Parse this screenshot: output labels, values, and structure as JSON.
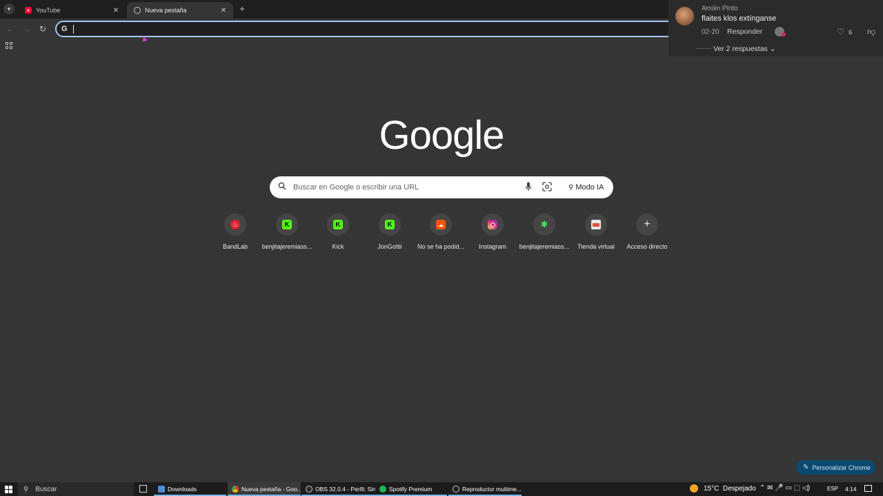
{
  "tabs": [
    {
      "label": "YouTube"
    },
    {
      "label": "Nueva pestaña"
    }
  ],
  "omnibox": {
    "value": ""
  },
  "comment": {
    "author": "Amiiin Pinto",
    "text": "flaites klos extínganse",
    "time": "02-20",
    "reply_label": "Responder",
    "likes": "6",
    "view_replies": "Ver 2 respuestas"
  },
  "logo": "Google",
  "search": {
    "placeholder": "Buscar en Google o escribir una URL",
    "ai_mode": "Modo IA"
  },
  "shortcuts": [
    {
      "label": "BandLab",
      "icon": "bandlab-icon",
      "color": "#e0212e"
    },
    {
      "label": "benjitajeremiass...",
      "icon": "kick-icon",
      "color": "#53fc18"
    },
    {
      "label": "Kick",
      "icon": "kick-icon",
      "color": "#53fc18"
    },
    {
      "label": "JonGottii",
      "icon": "kick-icon",
      "color": "#53fc18"
    },
    {
      "label": "No se ha podid...",
      "icon": "soundcloud-icon",
      "color": "#ff5500"
    },
    {
      "label": "Instagram",
      "icon": "instagram-icon",
      "color": "#d62976"
    },
    {
      "label": "benjitajeremiass...",
      "icon": "linktree-icon",
      "color": "#43e660"
    },
    {
      "label": "Tienda virtual",
      "icon": "store-icon",
      "color": "#e8e8e8"
    },
    {
      "label": "Acceso directo",
      "icon": "plus-icon",
      "color": "#454545"
    }
  ],
  "customize_label": "Personalizar Chrome",
  "taskbar": {
    "search_label": "Buscar",
    "apps": [
      {
        "label": "Downloads",
        "icon": "folder-icon",
        "color": "#4a90d9"
      },
      {
        "label": "Nueva pestaña - Goo...",
        "icon": "chrome-icon",
        "color": "#4285f4"
      },
      {
        "label": "OBS 32.0.4 - Perfil: Sin...",
        "icon": "obs-icon",
        "color": "#cccccc"
      },
      {
        "label": "Spotify Premium",
        "icon": "spotify-icon",
        "color": "#1db954"
      },
      {
        "label": "Reproductor multime...",
        "icon": "media-player-icon",
        "color": "#e04e39"
      }
    ],
    "weather": "15°C  Despejado",
    "tray_icons": "⌃ ✉ 🎤 ▭ ⬚ ◁) ",
    "language": "ESP",
    "time": "4:14"
  }
}
